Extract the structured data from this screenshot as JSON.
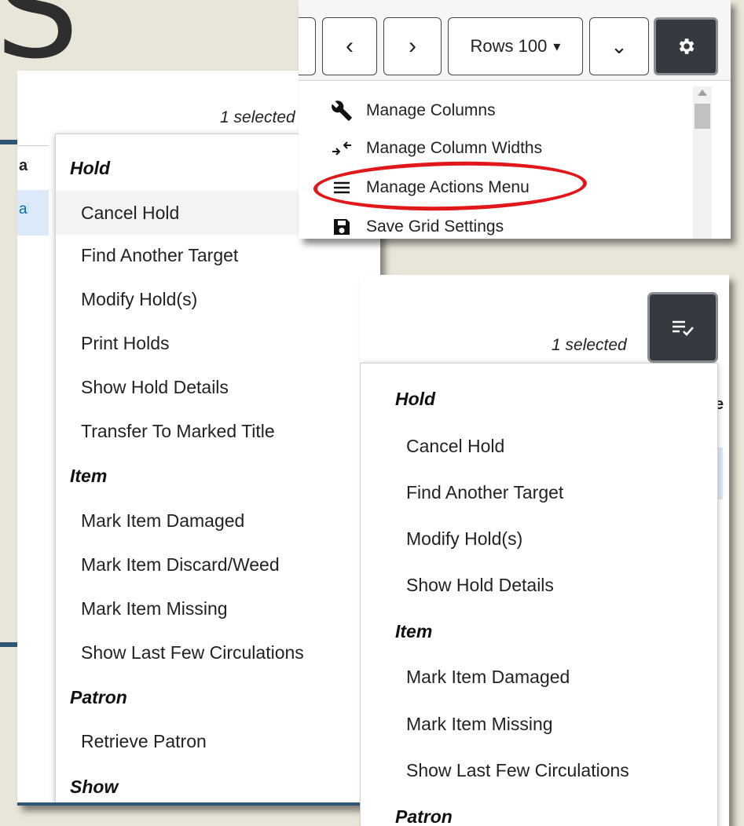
{
  "backdrop": {
    "heading_fragment": "S",
    "accent_color": "#2f5575"
  },
  "left_panel": {
    "selected": "1 selected",
    "header_fragment": "ay",
    "row_fragment": "ally",
    "menu": [
      {
        "type": "group",
        "label": "Hold"
      },
      {
        "type": "item",
        "label": "Cancel Hold",
        "highlighted": true
      },
      {
        "type": "item",
        "label": "Find Another Target"
      },
      {
        "type": "item",
        "label": "Modify Hold(s)"
      },
      {
        "type": "item",
        "label": "Print Holds"
      },
      {
        "type": "item",
        "label": "Show Hold Details"
      },
      {
        "type": "item",
        "label": "Transfer To Marked Title"
      },
      {
        "type": "group",
        "label": "Item"
      },
      {
        "type": "item",
        "label": "Mark Item Damaged"
      },
      {
        "type": "item",
        "label": "Mark Item Discard/Weed"
      },
      {
        "type": "item",
        "label": "Mark Item Missing"
      },
      {
        "type": "item",
        "label": "Show Last Few Circulations"
      },
      {
        "type": "group",
        "label": "Patron"
      },
      {
        "type": "item",
        "label": "Retrieve Patron"
      },
      {
        "type": "group",
        "label": "Show"
      }
    ]
  },
  "settings_panel": {
    "toolbar": {
      "prev_label": "‹",
      "next_label": "›",
      "rows_label": "Rows 100",
      "rows_caret": "▾",
      "expand_label": "⌄",
      "gear_icon": "gear-icon"
    },
    "menu": [
      {
        "label": "Manage Columns",
        "icon": "wrench-icon"
      },
      {
        "label": "Manage Column Widths",
        "icon": "column-resize-icon"
      },
      {
        "label": "Manage Actions Menu",
        "icon": "menu-lines-icon",
        "circled": true
      },
      {
        "label": "Save Grid Settings",
        "icon": "save-icon"
      }
    ],
    "circle_color": "#e1181b"
  },
  "actions_panel": {
    "selected": "1 selected",
    "button_icon": "list-check-icon",
    "edge_fragment": "e",
    "menu": [
      {
        "type": "group",
        "label": "Hold"
      },
      {
        "type": "item",
        "label": "Cancel Hold"
      },
      {
        "type": "item",
        "label": "Find Another Target"
      },
      {
        "type": "item",
        "label": "Modify Hold(s)"
      },
      {
        "type": "item",
        "label": "Show Hold Details"
      },
      {
        "type": "group",
        "label": "Item"
      },
      {
        "type": "item",
        "label": "Mark Item Damaged"
      },
      {
        "type": "item",
        "label": "Mark Item Missing"
      },
      {
        "type": "item",
        "label": "Show Last Few Circulations"
      },
      {
        "type": "group",
        "label": "Patron"
      }
    ]
  }
}
